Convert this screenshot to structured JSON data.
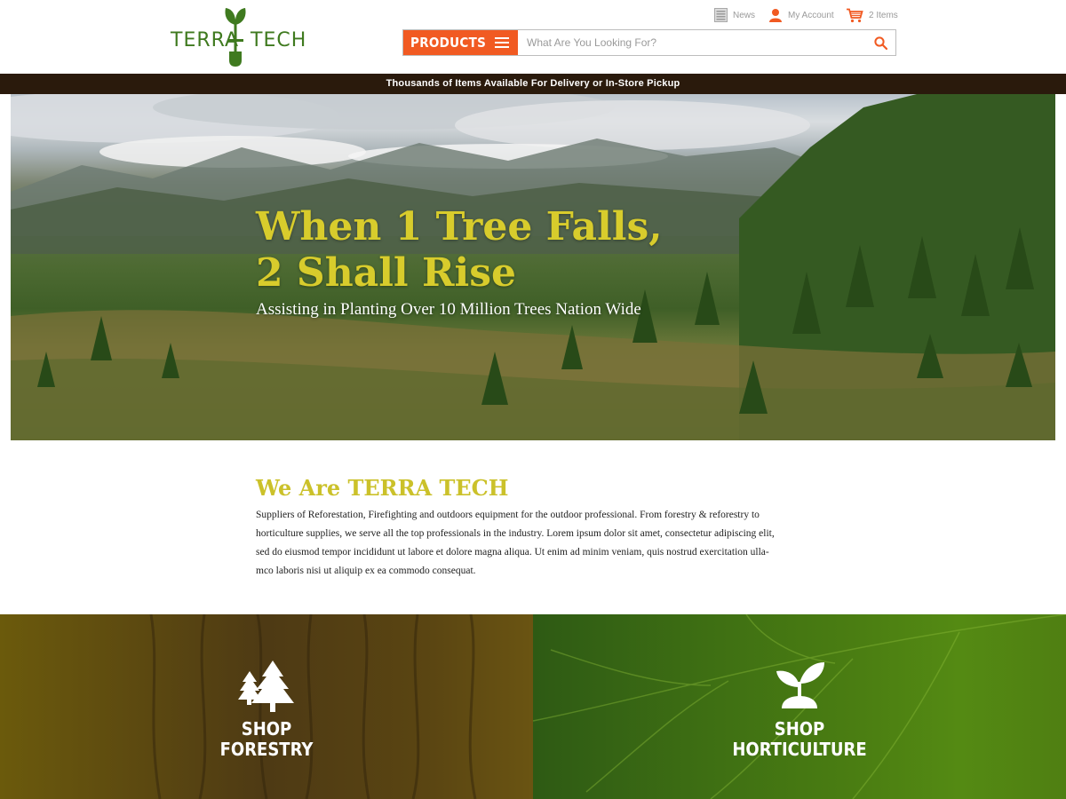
{
  "brand": {
    "name_left": "TERRA",
    "name_right": "TECH",
    "colors": {
      "green": "#3f7a1f",
      "orange": "#f15a22",
      "yellow": "#d8cc2c",
      "dark_brown": "#2a1a0c"
    }
  },
  "utility": {
    "news": {
      "label": "News",
      "icon": "news-icon"
    },
    "account": {
      "label": "My Account",
      "icon": "user-icon"
    },
    "cart": {
      "label": "2 Items",
      "icon": "cart-icon"
    }
  },
  "search": {
    "products_label": "PRODUCTS",
    "placeholder": "What Are You Looking For?",
    "value": ""
  },
  "announcement": "Thousands of Items Available For Delivery or In-Store Pickup",
  "hero": {
    "title_line1": "When 1 Tree Falls,",
    "title_line2": "2 Shall Rise",
    "subtitle": "Assisting in Planting Over 10 Million Trees Nation Wide"
  },
  "about": {
    "title": "We Are TERRA TECH",
    "line1": "Suppliers of Reforestation, Firefighting and outdoors equipment for the outdoor professional.  From forestry & reforestry to",
    "line2": "horticulture supplies, we serve all the top professionals in the industry. Lorem ipsum dolor sit amet, consectetur adipiscing elit,",
    "line3": "sed do eiusmod tempor incididunt ut labore et dolore magna aliqua. Ut enim ad minim veniam, quis nostrud exercitation ulla-",
    "line4": "mco laboris nisi ut aliquip ex ea commodo consequat."
  },
  "tiles": {
    "forestry": {
      "line1": "SHOP",
      "line2": "FORESTRY",
      "icon": "trees-icon"
    },
    "horticulture": {
      "line1": "SHOP",
      "line2": "HORTICULTURE",
      "icon": "sprout-icon"
    }
  }
}
